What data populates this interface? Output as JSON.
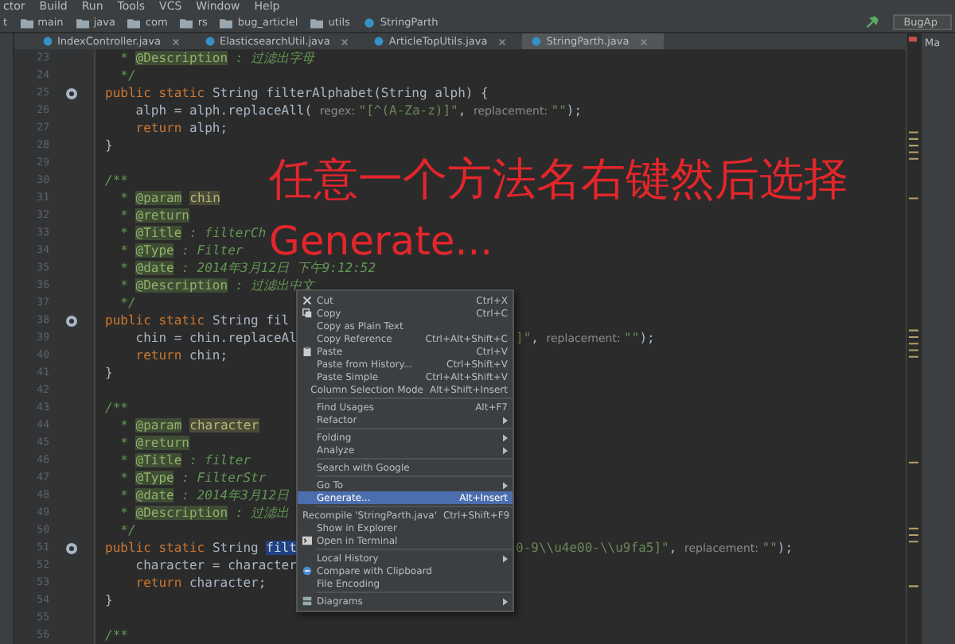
{
  "menu_bar": [
    "ctor",
    "Build",
    "Run",
    "Tools",
    "VCS",
    "Window",
    "Help"
  ],
  "breadcrumbs": [
    "t",
    "main",
    "java",
    "com",
    "rs",
    "bug_articlel",
    "utils",
    "StringParth"
  ],
  "run_config": "BugAp",
  "tabs": [
    {
      "label": "IndexController.java",
      "selected": false
    },
    {
      "label": "ElasticsearchUtil.java",
      "selected": false
    },
    {
      "label": "ArticleTopUtils.java",
      "selected": false
    },
    {
      "label": "StringParth.java",
      "selected": true
    }
  ],
  "side_panel": "Ma",
  "code_lines": [
    {
      "num": "23",
      "gutter_icon": false,
      "segs": [
        {
          "kind": "doc",
          "text": "  * "
        },
        {
          "kind": "tag",
          "text": "@Description"
        },
        {
          "kind": "doc",
          "text": " : 过滤出字母"
        }
      ]
    },
    {
      "num": "24",
      "gutter_icon": false,
      "segs": [
        {
          "kind": "doc",
          "text": "  */"
        }
      ]
    },
    {
      "num": "25",
      "gutter_icon": true,
      "segs": [
        {
          "kind": "kw",
          "text": "public static "
        },
        {
          "kind": "plain",
          "text": "String "
        },
        {
          "kind": "fn",
          "text": "filterAlphabet"
        },
        {
          "kind": "plain",
          "text": "(String alph) {"
        }
      ]
    },
    {
      "num": "26",
      "gutter_icon": false,
      "segs": [
        {
          "kind": "plain",
          "text": "    alph = alph.replaceAll( "
        },
        {
          "kind": "hint",
          "text": "regex: "
        },
        {
          "kind": "str",
          "text": "\"[^(A-Za-z)]\""
        },
        {
          "kind": "plain",
          "text": ", "
        },
        {
          "kind": "hint",
          "text": "replacement: "
        },
        {
          "kind": "str",
          "text": "\"\""
        },
        {
          "kind": "plain",
          "text": ");"
        }
      ]
    },
    {
      "num": "27",
      "gutter_icon": false,
      "segs": [
        {
          "kind": "kw",
          "text": "    return "
        },
        {
          "kind": "plain",
          "text": "alph;"
        }
      ]
    },
    {
      "num": "28",
      "gutter_icon": false,
      "segs": [
        {
          "kind": "plain",
          "text": "}"
        }
      ]
    },
    {
      "num": "29",
      "gutter_icon": false
    },
    {
      "num": "30",
      "gutter_icon": false,
      "segs": [
        {
          "kind": "doc",
          "text": "/**"
        }
      ]
    },
    {
      "num": "31",
      "gutter_icon": false,
      "segs": [
        {
          "kind": "doc",
          "text": "  * "
        },
        {
          "kind": "tag",
          "text": "@param"
        },
        {
          "kind": "tagval",
          "text": "chin"
        }
      ]
    },
    {
      "num": "32",
      "gutter_icon": false,
      "segs": [
        {
          "kind": "doc",
          "text": "  * "
        },
        {
          "kind": "tag",
          "text": "@return"
        }
      ]
    },
    {
      "num": "33",
      "gutter_icon": false,
      "segs": [
        {
          "kind": "doc",
          "text": "  * "
        },
        {
          "kind": "tag",
          "text": "@Title"
        },
        {
          "kind": "doc",
          "text": " : filterCh"
        }
      ]
    },
    {
      "num": "34",
      "gutter_icon": false,
      "segs": [
        {
          "kind": "doc",
          "text": "  * "
        },
        {
          "kind": "tag",
          "text": "@Type"
        },
        {
          "kind": "doc",
          "text": " : Filter"
        }
      ]
    },
    {
      "num": "35",
      "gutter_icon": false,
      "segs": [
        {
          "kind": "doc",
          "text": "  * "
        },
        {
          "kind": "tag",
          "text": "@date"
        },
        {
          "kind": "doc",
          "text": " : 2014年3月12日 下午9:12:52"
        }
      ]
    },
    {
      "num": "36",
      "gutter_icon": false,
      "segs": [
        {
          "kind": "doc",
          "text": "  * "
        },
        {
          "kind": "tag",
          "text": "@Description"
        },
        {
          "kind": "doc",
          "text": " : 过滤出中文"
        }
      ]
    },
    {
      "num": "37",
      "gutter_icon": false,
      "segs": [
        {
          "kind": "doc",
          "text": "  */"
        }
      ]
    },
    {
      "num": "38",
      "gutter_icon": true,
      "segs": [
        {
          "kind": "kw",
          "text": "public static "
        },
        {
          "kind": "plain",
          "text": "String "
        },
        {
          "kind": "fn",
          "text": "fil"
        }
      ]
    },
    {
      "num": "39",
      "gutter_icon": false,
      "segs": [
        {
          "kind": "plain",
          "text": "    chin = chin.replaceAl"
        }
      ],
      "tail": [
        {
          "kind": "str",
          "text": "]\""
        },
        {
          "kind": "plain",
          "text": ", "
        },
        {
          "kind": "hint",
          "text": "replacement: "
        },
        {
          "kind": "str",
          "text": "\"\""
        },
        {
          "kind": "plain",
          "text": ");"
        }
      ]
    },
    {
      "num": "40",
      "gutter_icon": false,
      "segs": [
        {
          "kind": "kw",
          "text": "    return "
        },
        {
          "kind": "plain",
          "text": "chin;"
        }
      ]
    },
    {
      "num": "41",
      "gutter_icon": false,
      "segs": [
        {
          "kind": "plain",
          "text": "}"
        }
      ]
    },
    {
      "num": "42",
      "gutter_icon": false
    },
    {
      "num": "43",
      "gutter_icon": false,
      "segs": [
        {
          "kind": "doc",
          "text": "/**"
        }
      ]
    },
    {
      "num": "44",
      "gutter_icon": false,
      "segs": [
        {
          "kind": "doc",
          "text": "  * "
        },
        {
          "kind": "tag",
          "text": "@param"
        },
        {
          "kind": "tagval",
          "text": "character"
        }
      ]
    },
    {
      "num": "45",
      "gutter_icon": false,
      "segs": [
        {
          "kind": "doc",
          "text": "  * "
        },
        {
          "kind": "tag",
          "text": "@return"
        }
      ]
    },
    {
      "num": "46",
      "gutter_icon": false,
      "segs": [
        {
          "kind": "doc",
          "text": "  * "
        },
        {
          "kind": "tag",
          "text": "@Title"
        },
        {
          "kind": "doc",
          "text": " : filter"
        }
      ]
    },
    {
      "num": "47",
      "gutter_icon": false,
      "segs": [
        {
          "kind": "doc",
          "text": "  * "
        },
        {
          "kind": "tag",
          "text": "@Type"
        },
        {
          "kind": "doc",
          "text": " : FilterStr"
        }
      ]
    },
    {
      "num": "48",
      "gutter_icon": false,
      "segs": [
        {
          "kind": "doc",
          "text": "  * "
        },
        {
          "kind": "tag",
          "text": "@date"
        },
        {
          "kind": "doc",
          "text": " : 2014年3月12日"
        }
      ]
    },
    {
      "num": "49",
      "gutter_icon": false,
      "segs": [
        {
          "kind": "doc",
          "text": "  * "
        },
        {
          "kind": "tag",
          "text": "@Description"
        },
        {
          "kind": "doc",
          "text": " : 过滤出"
        }
      ]
    },
    {
      "num": "50",
      "gutter_icon": false,
      "segs": [
        {
          "kind": "doc",
          "text": "  */"
        }
      ]
    },
    {
      "num": "51",
      "gutter_icon": true,
      "segs": [
        {
          "kind": "kw",
          "text": "public static "
        },
        {
          "kind": "plain",
          "text": "String "
        },
        {
          "kind": "sel",
          "text": "filt"
        }
      ],
      "tail": [
        {
          "kind": "str",
          "text": "0-9\\\\u4e00-\\\\u9fa5"
        },
        {
          "kind": "str",
          "text": "]\""
        },
        {
          "kind": "plain",
          "text": ", "
        },
        {
          "kind": "hint",
          "text": "replacement: "
        },
        {
          "kind": "str",
          "text": "\"\""
        },
        {
          "kind": "plain",
          "text": ");"
        }
      ]
    },
    {
      "num": "52",
      "gutter_icon": false,
      "segs": [
        {
          "kind": "plain",
          "text": "    character = character"
        }
      ]
    },
    {
      "num": "53",
      "gutter_icon": false,
      "segs": [
        {
          "kind": "kw",
          "text": "    return "
        },
        {
          "kind": "plain",
          "text": "character;"
        }
      ]
    },
    {
      "num": "54",
      "gutter_icon": false,
      "segs": [
        {
          "kind": "plain",
          "text": "}"
        }
      ]
    },
    {
      "num": "55",
      "gutter_icon": false
    },
    {
      "num": "56",
      "gutter_icon": false,
      "segs": [
        {
          "kind": "doc",
          "text": "/**"
        }
      ]
    }
  ],
  "context_menu": [
    {
      "kind": "item",
      "label": "Cut",
      "shortcut": "Ctrl+X",
      "submenu": false,
      "selected": false
    },
    {
      "kind": "item",
      "label": "Copy",
      "shortcut": "Ctrl+C",
      "submenu": false,
      "selected": false
    },
    {
      "kind": "item",
      "label": "Copy as Plain Text",
      "submenu": false,
      "selected": false
    },
    {
      "kind": "item",
      "label": "Copy Reference",
      "shortcut": "Ctrl+Alt+Shift+C",
      "submenu": false,
      "selected": false
    },
    {
      "kind": "item",
      "label": "Paste",
      "shortcut": "Ctrl+V",
      "submenu": false,
      "selected": false
    },
    {
      "kind": "item",
      "label": "Paste from History...",
      "shortcut": "Ctrl+Shift+V",
      "submenu": false,
      "selected": false
    },
    {
      "kind": "item",
      "label": "Paste Simple",
      "shortcut": "Ctrl+Alt+Shift+V",
      "submenu": false,
      "selected": false
    },
    {
      "kind": "item",
      "label": "Column Selection Mode",
      "shortcut": "Alt+Shift+Insert",
      "submenu": false,
      "selected": false
    },
    {
      "kind": "separator"
    },
    {
      "kind": "item",
      "label": "Find Usages",
      "shortcut": "Alt+F7",
      "submenu": false,
      "selected": false
    },
    {
      "kind": "item",
      "label": "Refactor",
      "submenu": true,
      "selected": false
    },
    {
      "kind": "separator"
    },
    {
      "kind": "item",
      "label": "Folding",
      "submenu": true,
      "selected": false
    },
    {
      "kind": "item",
      "label": "Analyze",
      "submenu": true,
      "selected": false
    },
    {
      "kind": "separator"
    },
    {
      "kind": "item",
      "label": "Search with Google",
      "submenu": false,
      "selected": false
    },
    {
      "kind": "separator"
    },
    {
      "kind": "item",
      "label": "Go To",
      "submenu": true,
      "selected": false
    },
    {
      "kind": "item",
      "label": "Generate...",
      "shortcut": "Alt+Insert",
      "submenu": false,
      "selected": true
    },
    {
      "kind": "separator"
    },
    {
      "kind": "item",
      "label": "Recompile 'StringParth.java'",
      "shortcut": "Ctrl+Shift+F9",
      "submenu": false,
      "selected": false
    },
    {
      "kind": "item",
      "label": "Show in Explorer",
      "submenu": false,
      "selected": false
    },
    {
      "kind": "item",
      "label": "Open in Terminal",
      "submenu": false,
      "selected": false
    },
    {
      "kind": "separator"
    },
    {
      "kind": "item",
      "label": "Local History",
      "submenu": true,
      "selected": false
    },
    {
      "kind": "item",
      "label": "Compare with Clipboard",
      "submenu": false,
      "selected": false
    },
    {
      "kind": "item",
      "label": "File Encoding",
      "submenu": false,
      "selected": false
    },
    {
      "kind": "separator"
    },
    {
      "kind": "item",
      "label": "Diagrams",
      "submenu": true,
      "selected": false
    }
  ],
  "annotation": [
    "任意一个方法名右键然后选择",
    "Generate..."
  ]
}
